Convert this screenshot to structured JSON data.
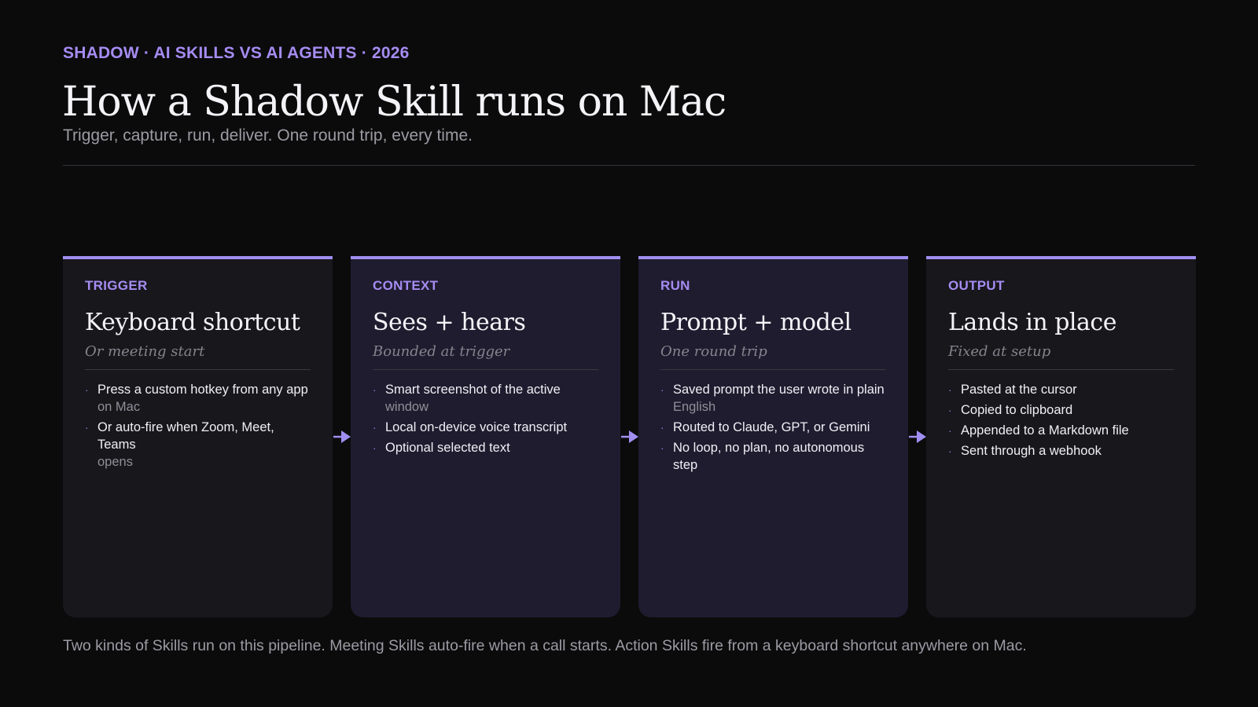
{
  "header": {
    "eyebrow": "SHADOW · AI SKILLS VS AI AGENTS · 2026",
    "title": "How a Shadow Skill runs on Mac",
    "subtitle": "Trigger, capture, run, deliver. One round trip, every time."
  },
  "colors": {
    "accent": "#a68cf2",
    "background": "#0b0b0c",
    "card_dark": "#17171c",
    "card_purple": "#1e1c2e"
  },
  "stages": [
    {
      "label": "TRIGGER",
      "heading": "Keyboard shortcut",
      "subheading": "Or meeting start",
      "bullets": [
        {
          "main": "Press a custom hotkey from any app",
          "cont": "on Mac"
        },
        {
          "main": "Or auto-fire when Zoom, Meet, Teams",
          "cont": "opens"
        }
      ]
    },
    {
      "label": "CONTEXT",
      "heading": "Sees + hears",
      "subheading": "Bounded at trigger",
      "bullets": [
        {
          "main": "Smart screenshot of the active",
          "cont": "window"
        },
        {
          "main": "Local on-device voice transcript",
          "cont": ""
        },
        {
          "main": "Optional selected text",
          "cont": ""
        }
      ]
    },
    {
      "label": "RUN",
      "heading": "Prompt + model",
      "subheading": "One round trip",
      "bullets": [
        {
          "main": "Saved prompt the user wrote in plain",
          "cont": "English"
        },
        {
          "main": "Routed to Claude, GPT, or Gemini",
          "cont": ""
        },
        {
          "main": "No loop, no plan, no autonomous step",
          "cont": ""
        }
      ]
    },
    {
      "label": "OUTPUT",
      "heading": "Lands in place",
      "subheading": "Fixed at setup",
      "bullets": [
        {
          "main": "Pasted at the cursor",
          "cont": ""
        },
        {
          "main": "Copied to clipboard",
          "cont": ""
        },
        {
          "main": "Appended to a Markdown file",
          "cont": ""
        },
        {
          "main": "Sent through a webhook",
          "cont": ""
        }
      ]
    }
  ],
  "footer": "Two kinds of Skills run on this pipeline. Meeting Skills auto-fire when a call starts. Action Skills fire from a keyboard shortcut anywhere on Mac."
}
